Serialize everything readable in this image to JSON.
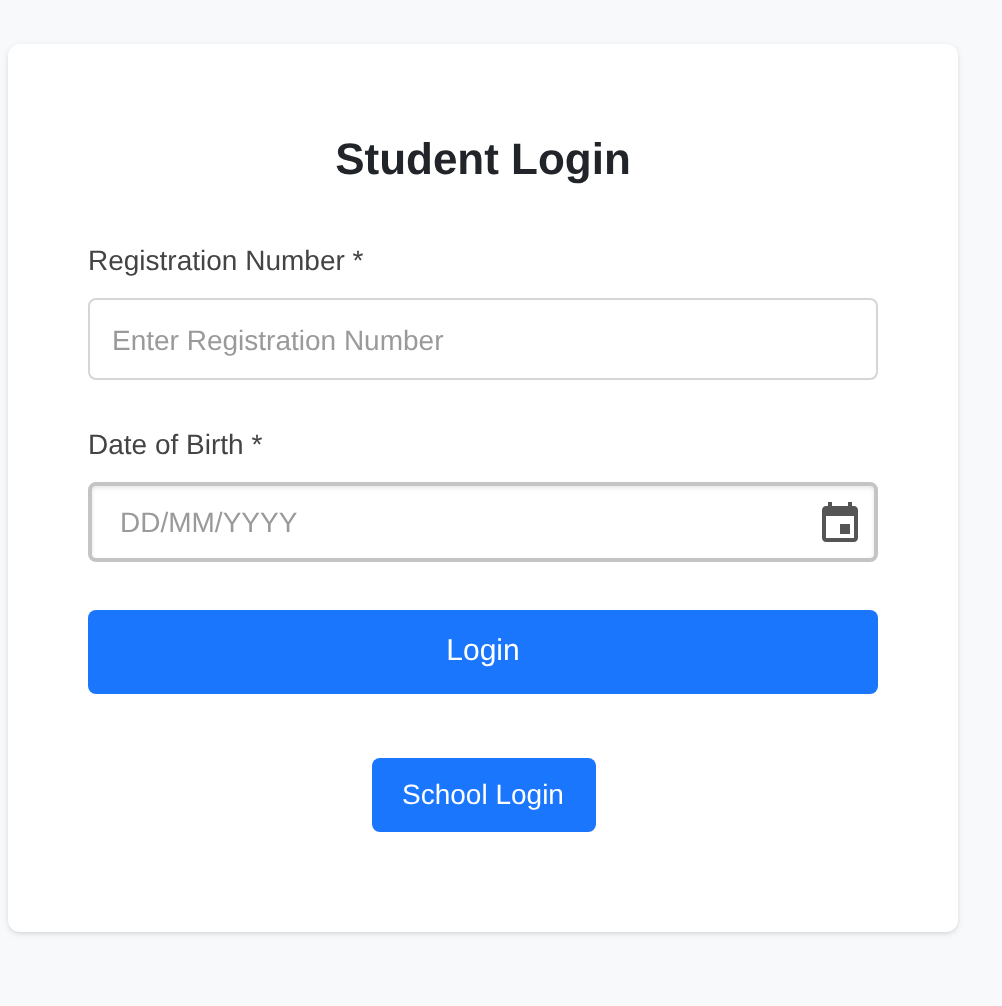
{
  "title": "Student Login",
  "fields": [
    {
      "kind": "text",
      "label": "Registration Number *",
      "placeholder": "Enter Registration Number"
    },
    {
      "kind": "date",
      "label": "Date of Birth *",
      "placeholder": "DD/MM/YYYY"
    }
  ],
  "buttons": [
    {
      "kind": "primary",
      "label": "Login"
    },
    {
      "kind": "secondary",
      "label": "School Login"
    }
  ]
}
